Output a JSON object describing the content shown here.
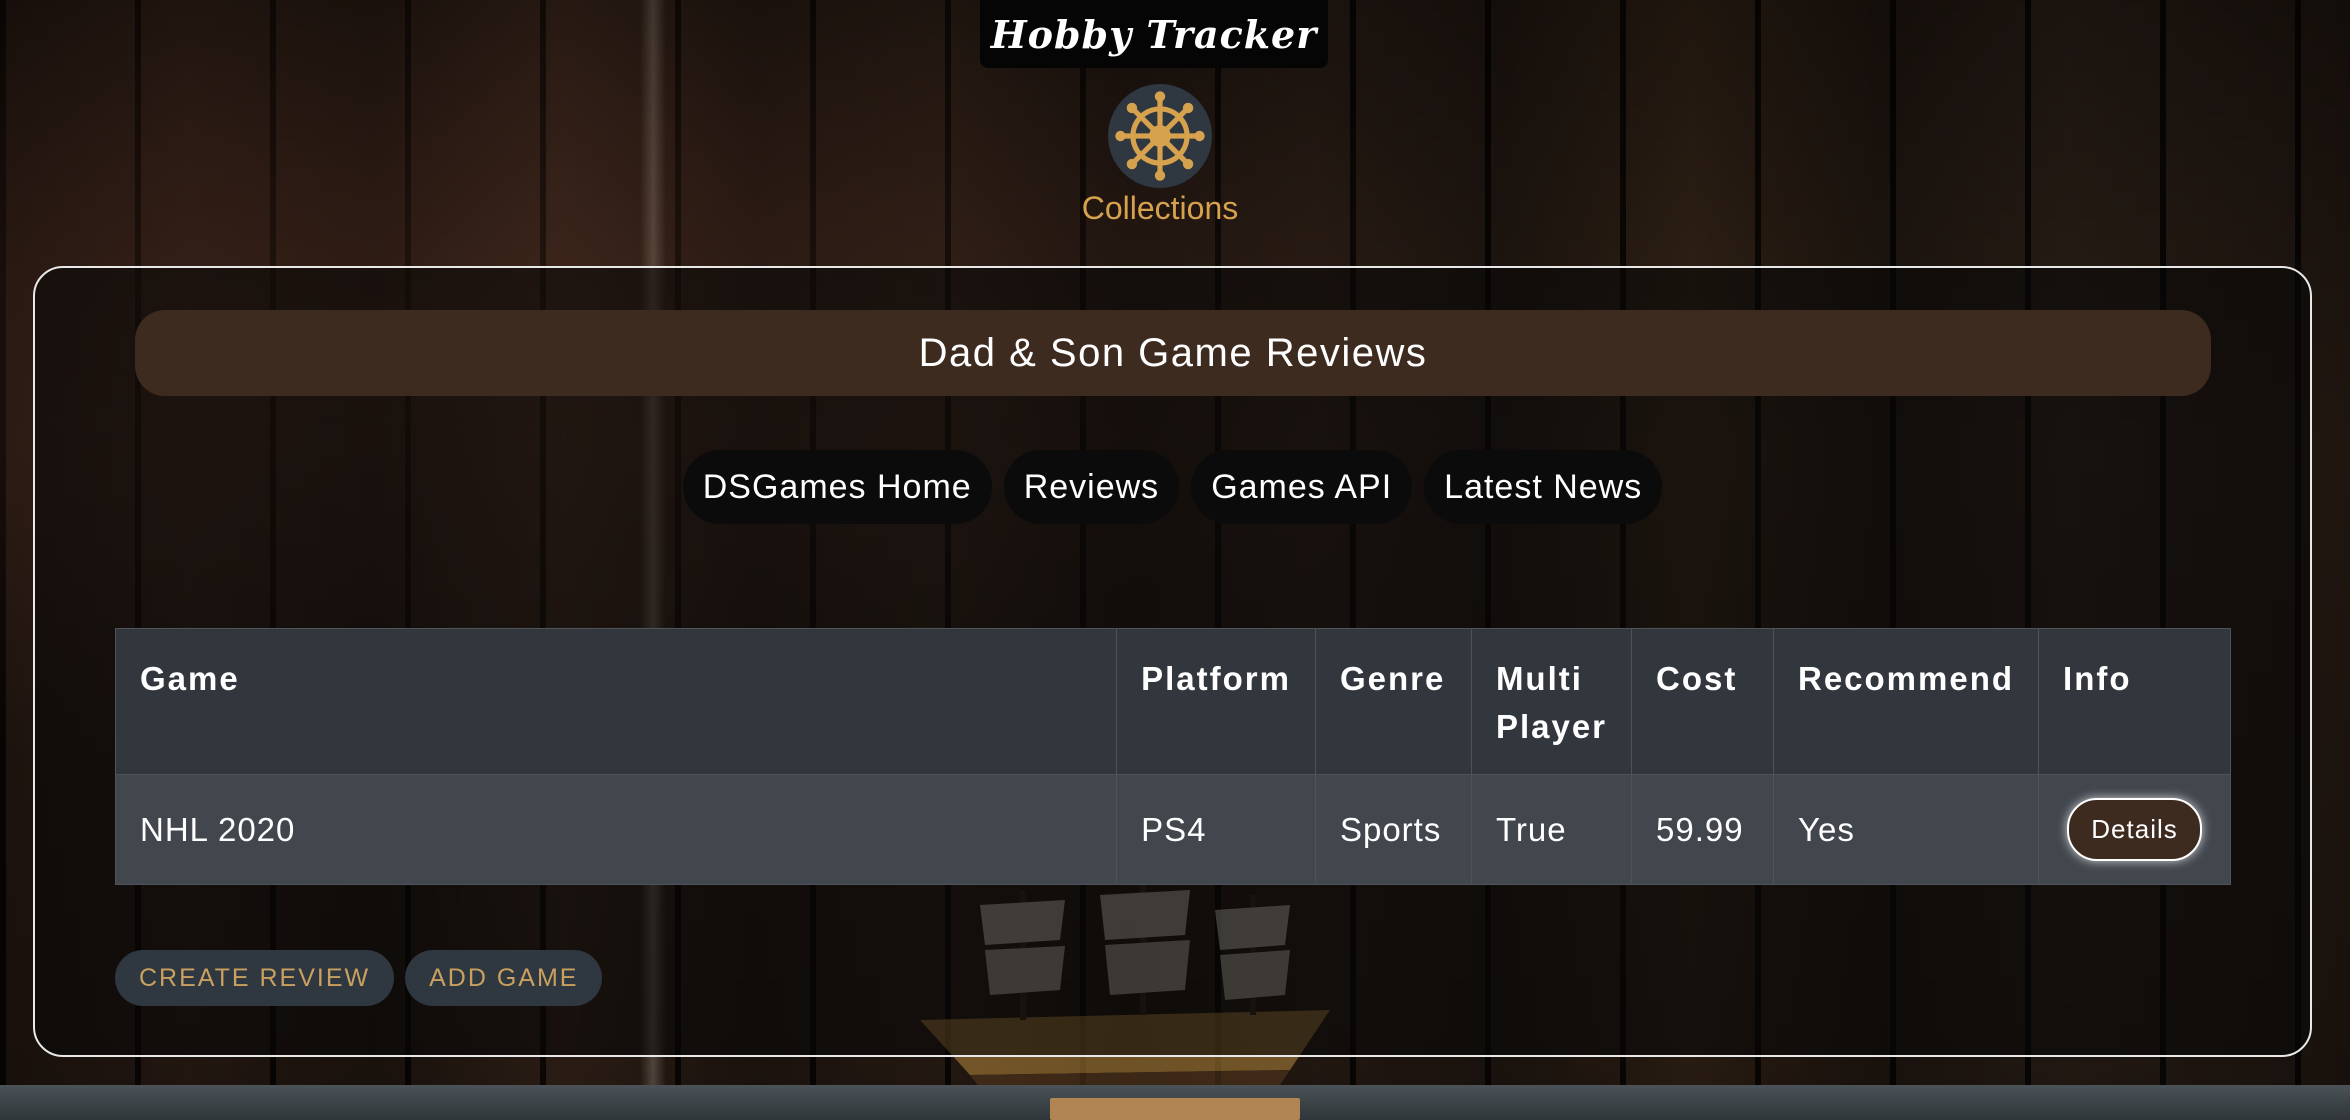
{
  "app": {
    "title": "Hobby Tracker"
  },
  "collections": {
    "label": "Collections",
    "icon": "ship-wheel-icon"
  },
  "banner": {
    "title": "Dad & Son Game Reviews"
  },
  "nav": {
    "items": [
      "DSGames Home",
      "Reviews",
      "Games API",
      "Latest News"
    ]
  },
  "table": {
    "headers": {
      "game": "Game",
      "platform": "Platform",
      "genre": "Genre",
      "multi_line1": "Multi",
      "multi_line2": "Player",
      "cost": "Cost",
      "recommend": "Recommend",
      "info": "Info"
    },
    "rows": [
      {
        "game": "NHL 2020",
        "platform": "PS4",
        "genre": "Sports",
        "multiplayer": "True",
        "cost": "59.99",
        "recommend": "Yes",
        "info_button": "Details"
      }
    ]
  },
  "actions": {
    "create_review": "Create Review",
    "add_game": "Add Game"
  },
  "colors": {
    "accent_gold": "#d6a24e",
    "banner_brown": "#3e2b20",
    "table_header": "#32363d",
    "table_row": "#42474e",
    "action_bg": "#2f3741"
  }
}
